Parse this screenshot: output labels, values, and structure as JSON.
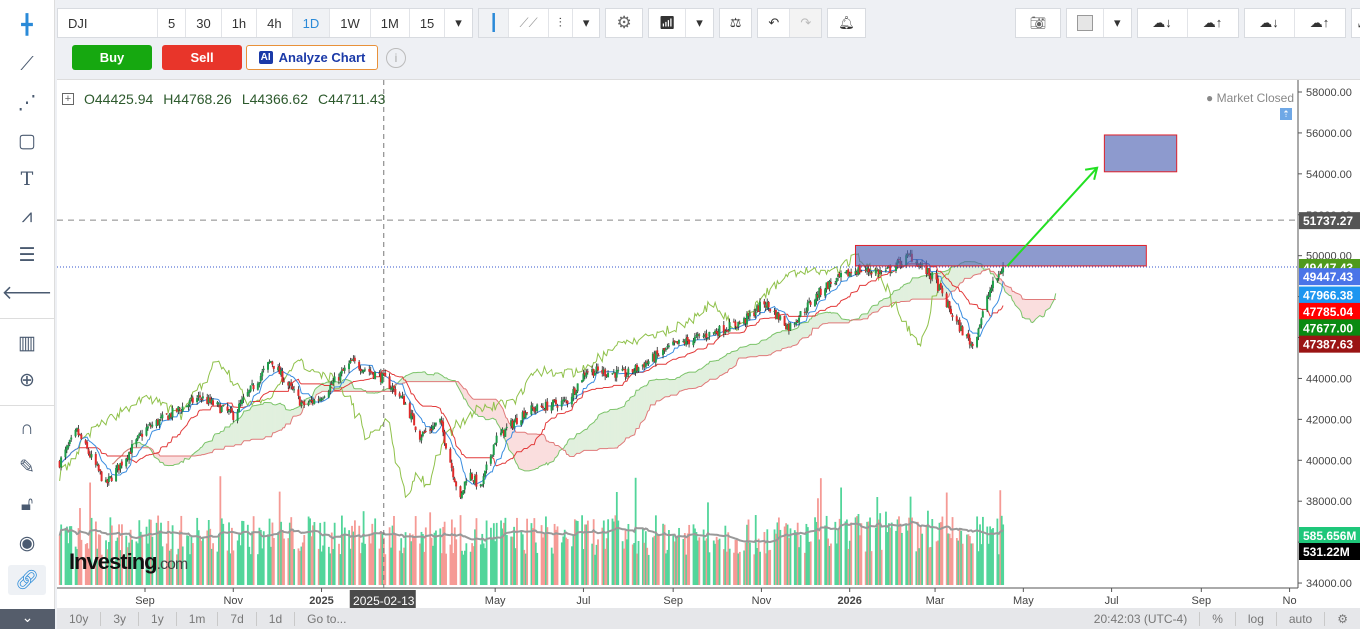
{
  "symbol": "DJI",
  "timeframes": [
    "5",
    "30",
    "1h",
    "4h",
    "1D",
    "1W",
    "1M",
    "15"
  ],
  "active_timeframe": "1D",
  "buttons": {
    "buy": "Buy",
    "sell": "Sell",
    "analyze": "Analyze Chart",
    "ai_badge": "AI",
    "info": "i"
  },
  "ohlc": {
    "o": "O44425.94",
    "h": "H44768.26",
    "l": "L44366.62",
    "c": "C44711.43"
  },
  "market_status": "Market Closed",
  "colors": {
    "buy": "#16a810",
    "sell": "#e8352a",
    "up": "#1e9e4a",
    "down": "#e02a2a",
    "accent": "#2a8ad8"
  },
  "price_axis": {
    "ticks": [
      "58000.00",
      "56000.00",
      "54000.00",
      "52000.00",
      "50000.00",
      "48000.00",
      "46000.00",
      "44000.00",
      "42000.00",
      "40000.00",
      "38000.00",
      "36000.00",
      "34000.00"
    ],
    "tags": [
      {
        "label": "51737.27",
        "value": 51737.27,
        "color": "#555555"
      },
      {
        "label": "49447.43",
        "value": 49447.43,
        "color": "#4f9a1c"
      },
      {
        "label": "49447.43",
        "value": 49000,
        "color": "#4a74e8"
      },
      {
        "label": "47966.38",
        "value": 48100,
        "color": "#1e96f0"
      },
      {
        "label": "47785.04",
        "value": 47300,
        "color": "#ff0000"
      },
      {
        "label": "47677.00",
        "value": 46500,
        "color": "#0a8a12"
      },
      {
        "label": "47387.63",
        "value": 45700,
        "color": "#9a1414"
      }
    ],
    "volume_tags": [
      {
        "label": "585.656M",
        "color": "#1ec77a"
      },
      {
        "label": "531.22M",
        "color": "#000000"
      }
    ]
  },
  "time_axis": {
    "labels": [
      [
        "Sep",
        "2024-09-01"
      ],
      [
        "Nov",
        "2024-11-01"
      ],
      [
        "2025",
        "2025-01-01"
      ],
      [
        "May",
        "2025-05-01"
      ],
      [
        "Jul",
        "2025-07-01"
      ],
      [
        "Sep",
        "2025-09-01"
      ],
      [
        "Nov",
        "2025-11-01"
      ],
      [
        "2026",
        "2026-01-01"
      ],
      [
        "Mar",
        "2026-03-01"
      ],
      [
        "May",
        "2026-05-01"
      ],
      [
        "Jul",
        "2026-07-01"
      ],
      [
        "Sep",
        "2026-09-01"
      ],
      [
        "No",
        "2026-11-01"
      ]
    ],
    "crosshair_label": "2025-02-13"
  },
  "chart_data": {
    "type": "candlestick",
    "symbol": "DJI",
    "ylim": [
      34000,
      59000
    ],
    "close_path": [
      [
        "2024-07-04",
        39900
      ],
      [
        "2024-07-16",
        41400
      ],
      [
        "2024-08-05",
        38800
      ],
      [
        "2024-09-01",
        41500
      ],
      [
        "2024-10-09",
        43100
      ],
      [
        "2024-11-01",
        42200
      ],
      [
        "2024-11-27",
        44850
      ],
      [
        "2024-12-19",
        42700
      ],
      [
        "2024-12-30",
        43000
      ],
      [
        "2025-01-22",
        44800
      ],
      [
        "2025-02-13",
        44000
      ],
      [
        "2025-02-27",
        42900
      ],
      [
        "2025-03-10",
        41200
      ],
      [
        "2025-03-24",
        41900
      ],
      [
        "2025-04-07",
        38000
      ],
      [
        "2025-04-12",
        39500
      ],
      [
        "2025-04-21",
        38600
      ],
      [
        "2025-05-01",
        41000
      ],
      [
        "2025-05-22",
        42400
      ],
      [
        "2025-06-20",
        42900
      ],
      [
        "2025-07-03",
        44400
      ],
      [
        "2025-07-31",
        44200
      ],
      [
        "2025-08-14",
        44800
      ],
      [
        "2025-09-01",
        45600
      ],
      [
        "2025-09-23",
        46100
      ],
      [
        "2025-10-20",
        46800
      ],
      [
        "2025-11-03",
        47700
      ],
      [
        "2025-11-20",
        46500
      ],
      [
        "2025-12-15",
        48500
      ],
      [
        "2026-01-05",
        49300
      ],
      [
        "2026-01-26",
        49200
      ],
      [
        "2026-02-12",
        50000
      ],
      [
        "2026-03-01",
        48800
      ],
      [
        "2026-03-15",
        46800
      ],
      [
        "2026-03-27",
        45600
      ],
      [
        "2026-04-08",
        48300
      ],
      [
        "2026-04-17",
        49447.43
      ]
    ],
    "drawings": {
      "rect1": [
        [
          "2026-01-05",
          50500
        ],
        [
          "2026-07-25",
          49500
        ]
      ],
      "rect2": [
        [
          "2026-06-26",
          55900
        ],
        [
          "2026-08-15",
          54100
        ]
      ],
      "arrow": [
        [
          "2026-04-20",
          49500
        ],
        [
          "2026-06-21",
          54300
        ]
      ],
      "hline": 51737.27
    }
  },
  "bottom": {
    "ranges": [
      "10y",
      "3y",
      "1y",
      "1m",
      "7d",
      "1d",
      "Go to..."
    ],
    "time": "20:42:03",
    "tz": "(UTC-4)",
    "pct": "%",
    "log": "log",
    "auto": "auto"
  },
  "watermark": "Investing.com"
}
